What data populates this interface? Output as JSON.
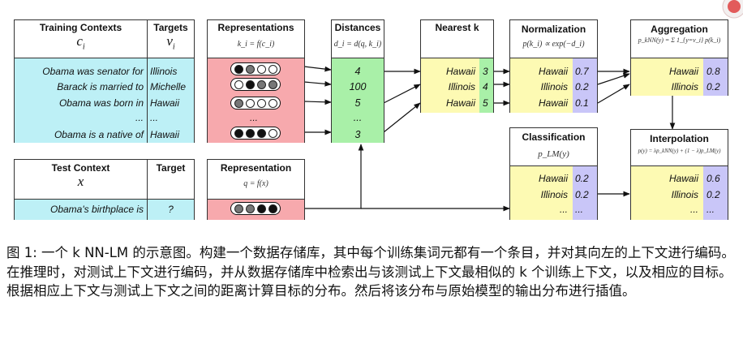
{
  "figure": {
    "training_contexts": {
      "header": "Training Contexts",
      "symbol": "c",
      "symbol_sub": "i",
      "rows": [
        "Obama was senator for",
        "Barack is married to",
        "Obama was born in",
        "...",
        "Obama is a native of"
      ]
    },
    "targets": {
      "header": "Targets",
      "symbol": "v",
      "symbol_sub": "i",
      "rows": [
        "Illinois",
        "Michelle",
        "Hawaii",
        "...",
        "Hawaii"
      ]
    },
    "representations": {
      "header": "Representations",
      "formula": "k_i = f(c_i)",
      "ellipsis": "..."
    },
    "distances": {
      "header": "Distances",
      "formula": "d_i = d(q, k_i)",
      "rows": [
        "4",
        "100",
        "5",
        "...",
        "3"
      ]
    },
    "nearest": {
      "header": "Nearest k",
      "rows": [
        {
          "label": "Hawaii",
          "value": "3"
        },
        {
          "label": "Illinois",
          "value": "4"
        },
        {
          "label": "Hawaii",
          "value": "5"
        }
      ]
    },
    "normalization": {
      "header": "Normalization",
      "formula": "p(k_i) ∝ exp(−d_i)",
      "rows": [
        {
          "label": "Hawaii",
          "value": "0.7"
        },
        {
          "label": "Illinois",
          "value": "0.2"
        },
        {
          "label": "Hawaii",
          "value": "0.1"
        }
      ]
    },
    "aggregation": {
      "header": "Aggregation",
      "formula": "p_kNN(y) = Σ 1_{y=v_i} p(k_i)",
      "rows": [
        {
          "label": "Hawaii",
          "value": "0.8"
        },
        {
          "label": "Illinois",
          "value": "0.2"
        }
      ]
    },
    "test_context": {
      "header": "Test Context",
      "symbol": "x",
      "value": "Obama's birthplace is"
    },
    "target": {
      "header": "Target",
      "value": "?"
    },
    "representation": {
      "header": "Representation",
      "formula": "q = f(x)"
    },
    "classification": {
      "header": "Classification",
      "formula": "p_LM(y)",
      "rows": [
        {
          "label": "Hawaii",
          "value": "0.2"
        },
        {
          "label": "Illinois",
          "value": "0.2"
        },
        {
          "label": "...",
          "value": "..."
        }
      ]
    },
    "interpolation": {
      "header": "Interpolation",
      "formula": "p(y) = λp_kNN(y) + (1 − λ)p_LM(y)",
      "rows": [
        {
          "label": "Hawaii",
          "value": "0.6"
        },
        {
          "label": "Illinois",
          "value": "0.2"
        },
        {
          "label": "...",
          "value": "..."
        }
      ]
    },
    "circle_patterns": [
      [
        "#111",
        "#777",
        "#fff",
        "#fff"
      ],
      [
        "#fff",
        "#111",
        "#777",
        "#777"
      ],
      [
        "#777",
        "#fff",
        "#fff",
        "#fff"
      ],
      [
        "#111",
        "#111",
        "#111",
        "#fff"
      ],
      [
        "#777",
        "#777",
        "#111",
        "#111"
      ]
    ]
  },
  "caption": {
    "text": "图 1: 一个 k NN-LM 的示意图。构建一个数据存储库，其中每个训练集词元都有一个条目，并对其向左的上下文进行编码。在推理时，对测试上下文进行编码，并从数据存储库中检索出与该测试上下文最相似的 k 个训练上下文，以及相应的目标。根据相应上下文与测试上下文之间的距离计算目标的分布。然后将该分布与原始模型的输出分布进行插值。"
  }
}
